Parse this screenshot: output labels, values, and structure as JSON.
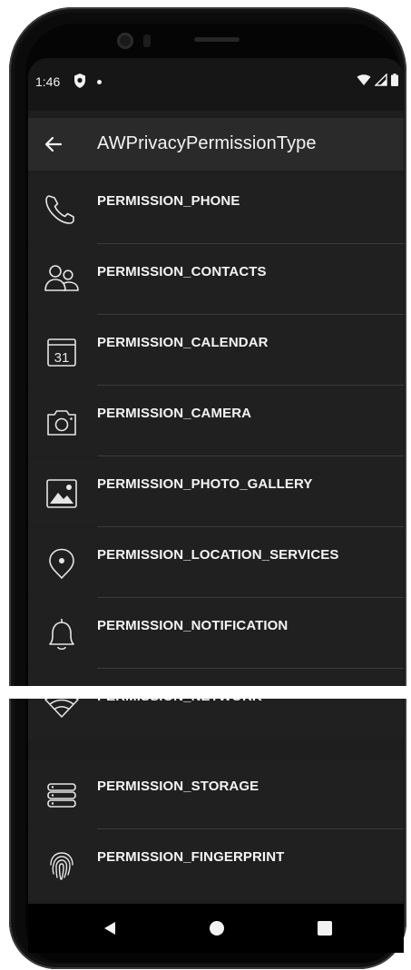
{
  "status_bar": {
    "time": "1:46",
    "icons": [
      "shield-icon",
      "notification-dot-icon",
      "wifi-icon",
      "cellular-icon",
      "battery-icon"
    ]
  },
  "app_bar": {
    "back_icon": "arrow-back-icon",
    "title": "AWPrivacyPermissionType"
  },
  "permissions": [
    {
      "label": "PERMISSION_PHONE",
      "icon": "phone-icon"
    },
    {
      "label": "PERMISSION_CONTACTS",
      "icon": "contacts-icon"
    },
    {
      "label": "PERMISSION_CALENDAR",
      "icon": "calendar-icon",
      "icon_text": "31"
    },
    {
      "label": "PERMISSION_CAMERA",
      "icon": "camera-icon"
    },
    {
      "label": "PERMISSION_PHOTO_GALLERY",
      "icon": "photo-gallery-icon"
    },
    {
      "label": "PERMISSION_LOCATION_SERVICES",
      "icon": "location-pin-icon"
    },
    {
      "label": "PERMISSION_NOTIFICATION",
      "icon": "bell-icon"
    },
    {
      "label": "PERMISSION_NETWORK",
      "icon": "wifi-icon"
    },
    {
      "label": "PERMISSION_STORAGE",
      "icon": "storage-icon"
    },
    {
      "label": "PERMISSION_FINGERPRINT",
      "icon": "fingerprint-icon"
    }
  ],
  "nav_bar": {
    "icons": [
      "nav-back-icon",
      "nav-home-icon",
      "nav-recents-icon"
    ]
  },
  "colors": {
    "background": "#1e1e1e",
    "app_bar": "#2a2a2a",
    "text": "#f4f4f4",
    "divider": "#3c3c3c"
  }
}
